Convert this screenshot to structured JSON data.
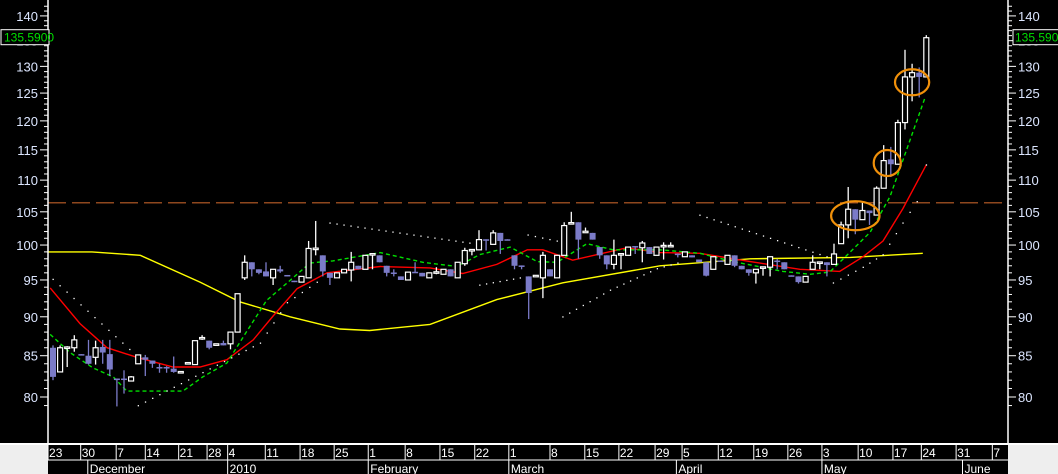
{
  "chart_data": {
    "type": "candlestick",
    "title": "",
    "scale": "log",
    "ylim": [
      79,
      142
    ],
    "y_ticks": [
      80,
      85,
      90,
      95,
      100,
      105,
      110,
      115,
      120,
      125,
      130,
      135,
      140
    ],
    "last_price_label": "135.5900",
    "reference_line": {
      "value": 106.4,
      "style": "dashed",
      "color": "#e07030"
    },
    "colors": {
      "up": "#ffffff",
      "down": "#7b7bc8",
      "ma_long": "#ffff00",
      "ma_mid": "#ff0000",
      "ma_fast": "#00e000",
      "sar": "#ffffff",
      "highlight": "#f0900a",
      "tag": "#00e000"
    },
    "candles_ohlc": [
      [
        86.0,
        86.3,
        82.0,
        82.4
      ],
      [
        83.0,
        86.3,
        83.0,
        86.0
      ],
      [
        86.1,
        86.2,
        83.6,
        86.1
      ],
      [
        86.0,
        87.6,
        85.5,
        87.0
      ],
      [
        85.2,
        85.2,
        85.1,
        85.1
      ],
      [
        85.0,
        87.0,
        83.9,
        84.0
      ],
      [
        84.8,
        86.9,
        83.9,
        86.0
      ],
      [
        86.1,
        87.0,
        84.0,
        85.4
      ],
      [
        85.2,
        87.0,
        82.5,
        83.3
      ],
      [
        82.2,
        82.2,
        78.9,
        82.1
      ],
      [
        82.2,
        83.2,
        80.4,
        82.1
      ],
      [
        81.9,
        82.5,
        81.9,
        82.4
      ],
      [
        84.0,
        85.1,
        84.0,
        85.1
      ],
      [
        84.8,
        85.1,
        82.5,
        84.5
      ],
      [
        84.4,
        84.4,
        83.5,
        84.0
      ],
      [
        83.6,
        84.0,
        82.9,
        83.5
      ],
      [
        83.6,
        83.7,
        82.9,
        83.5
      ],
      [
        83.4,
        84.9,
        82.9,
        83.0
      ],
      [
        83.0,
        83.0,
        83.0,
        83.05
      ],
      [
        84.1,
        84.1,
        84.1,
        84.15
      ],
      [
        83.9,
        86.9,
        83.9,
        86.9
      ],
      [
        87.3,
        87.6,
        87.0,
        87.3
      ],
      [
        86.9,
        86.9,
        85.8,
        86.0
      ],
      [
        86.3,
        86.5,
        86.3,
        86.5
      ],
      [
        86.6,
        86.9,
        86.3,
        86.3
      ],
      [
        86.5,
        88.0,
        85.8,
        88.0
      ],
      [
        88.0,
        93.1,
        88.0,
        93.1
      ],
      [
        95.3,
        98.5,
        95.0,
        97.5
      ],
      [
        97.5,
        97.5,
        95.5,
        96.5
      ],
      [
        96.5,
        96.5,
        95.8,
        96.0
      ],
      [
        96.2,
        97.5,
        95.5,
        95.5
      ],
      [
        95.3,
        96.5,
        94.3,
        96.5
      ],
      [
        96.5,
        97.0,
        96.0,
        96.2
      ],
      [
        95.7,
        95.7,
        95.5,
        95.6
      ],
      [
        94.9,
        94.9,
        94.7,
        94.8
      ],
      [
        94.7,
        95.5,
        94.7,
        95.5
      ],
      [
        95.3,
        100.6,
        95.3,
        99.5
      ],
      [
        99.5,
        103.6,
        98.5,
        99.55
      ],
      [
        98.5,
        98.5,
        95.5,
        96.2
      ],
      [
        96.0,
        96.0,
        94.3,
        95.3
      ],
      [
        95.3,
        96.0,
        95.3,
        96.0
      ],
      [
        96.0,
        96.5,
        96.0,
        96.5
      ],
      [
        96.4,
        99.0,
        94.8,
        97.5
      ],
      [
        97.0,
        97.0,
        96.5,
        96.5
      ],
      [
        96.5,
        98.5,
        96.5,
        98.5
      ],
      [
        98.7,
        98.7,
        96.5,
        98.75
      ],
      [
        98.5,
        98.5,
        97.5,
        97.5
      ],
      [
        97.0,
        97.0,
        95.5,
        96.0
      ],
      [
        96.05,
        96.5,
        95.5,
        96.0
      ],
      [
        95.5,
        95.5,
        95.0,
        95.0
      ],
      [
        95.0,
        96.1,
        95.0,
        96.1
      ],
      [
        96.15,
        97.5,
        96.1,
        96.1
      ],
      [
        96.0,
        96.0,
        95.5,
        95.5
      ],
      [
        95.3,
        96.0,
        95.3,
        96.0
      ],
      [
        96.1,
        96.8,
        95.8,
        96.15
      ],
      [
        95.8,
        96.5,
        95.8,
        96.5
      ],
      [
        96.5,
        96.5,
        95.5,
        95.5
      ],
      [
        95.3,
        97.5,
        95.3,
        97.5
      ],
      [
        97.3,
        99.6,
        97.0,
        99.2
      ],
      [
        99.3,
        99.3,
        98.5,
        99.35
      ],
      [
        99.3,
        102.2,
        99.3,
        100.8
      ],
      [
        100.85,
        100.85,
        99.2,
        100.8
      ],
      [
        100.1,
        102.2,
        100.1,
        101.8
      ],
      [
        101.8,
        101.8,
        98.7,
        100.6
      ],
      [
        100.85,
        100.85,
        100.8,
        100.8
      ],
      [
        98.5,
        98.5,
        96.5,
        97.0
      ],
      [
        97.05,
        97.05,
        96.5,
        97.0
      ],
      [
        95.5,
        95.5,
        89.7,
        93.2
      ],
      [
        95.6,
        95.6,
        95.6,
        95.65
      ],
      [
        95.3,
        99.0,
        92.5,
        98.5
      ],
      [
        96.5,
        96.5,
        95.5,
        95.5
      ],
      [
        95.3,
        98.5,
        95.3,
        98.5
      ],
      [
        98.5,
        103.4,
        98.5,
        102.9
      ],
      [
        103.3,
        105.0,
        103.3,
        103.35
      ],
      [
        103.4,
        103.4,
        98.0,
        100.8
      ],
      [
        102.0,
        102.6,
        102.0,
        102.05
      ],
      [
        101.8,
        101.8,
        100.8,
        100.8
      ],
      [
        99.7,
        99.7,
        98.0,
        98.5
      ],
      [
        98.5,
        98.5,
        96.5,
        97.2
      ],
      [
        97.2,
        100.8,
        96.5,
        98.5
      ],
      [
        98.7,
        98.7,
        96.5,
        98.75
      ],
      [
        98.5,
        99.7,
        98.5,
        99.7
      ],
      [
        99.85,
        99.85,
        98.7,
        99.8
      ],
      [
        99.6,
        100.6,
        97.5,
        100.3
      ],
      [
        99.7,
        99.7,
        98.7,
        98.7
      ],
      [
        98.5,
        99.7,
        98.5,
        99.7
      ],
      [
        99.9,
        100.4,
        97.9,
        99.95
      ],
      [
        99.9,
        100.4,
        99.9,
        99.95
      ],
      [
        98.75,
        98.75,
        98.2,
        98.7
      ],
      [
        98.3,
        99.0,
        98.3,
        99.0
      ],
      [
        98.5,
        98.5,
        98.2,
        98.2
      ],
      [
        97.9,
        97.9,
        97.5,
        97.5
      ],
      [
        97.5,
        97.5,
        95.5,
        95.6
      ],
      [
        96.5,
        98.3,
        96.5,
        98.3
      ],
      [
        97.75,
        97.75,
        97.7,
        97.7
      ],
      [
        97.2,
        98.5,
        97.2,
        98.5
      ],
      [
        98.5,
        98.5,
        96.8,
        97.0
      ],
      [
        97.0,
        97.0,
        96.5,
        96.5
      ],
      [
        96.5,
        96.5,
        95.6,
        96.0
      ],
      [
        96.0,
        96.5,
        94.5,
        96.5
      ],
      [
        96.8,
        96.8,
        95.6,
        96.85
      ],
      [
        96.8,
        98.3,
        95.5,
        98.3
      ],
      [
        97.75,
        98.0,
        96.5,
        97.7
      ],
      [
        97.5,
        97.5,
        96.5,
        96.5
      ],
      [
        95.65,
        95.65,
        95.6,
        95.6
      ],
      [
        95.5,
        95.5,
        94.5,
        94.7
      ],
      [
        94.7,
        95.5,
        94.7,
        95.5
      ],
      [
        96.5,
        98.5,
        96.5,
        97.5
      ],
      [
        97.5,
        97.5,
        96.5,
        97.55
      ],
      [
        97.5,
        97.5,
        95.5,
        97.1
      ],
      [
        97.2,
        100.2,
        97.2,
        98.7
      ],
      [
        100.2,
        103.5,
        100.2,
        103.0
      ],
      [
        103.0,
        108.9,
        101.0,
        105.4
      ],
      [
        105.4,
        105.4,
        101.6,
        103.8
      ],
      [
        103.8,
        106.5,
        103.8,
        105.2
      ],
      [
        105.2,
        105.2,
        103.0,
        104.8
      ],
      [
        104.5,
        109.0,
        104.5,
        108.7
      ],
      [
        108.7,
        115.8,
        108.7,
        113.2
      ],
      [
        113.4,
        115.5,
        110.5,
        112.6
      ],
      [
        112.6,
        120.2,
        112.6,
        119.7
      ],
      [
        119.7,
        133.2,
        118.5,
        128.0
      ],
      [
        128.0,
        130.5,
        123.5,
        128.8
      ],
      [
        128.8,
        129.8,
        124.2,
        128.0
      ],
      [
        128.0,
        136.1,
        128.0,
        135.59
      ]
    ],
    "ma_long": [
      [
        -0.8,
        99.0
      ],
      [
        5.5,
        99.0
      ],
      [
        12.3,
        98.5
      ],
      [
        20.7,
        94.7
      ],
      [
        26.3,
        92.0
      ],
      [
        33.4,
        90.0
      ],
      [
        40.4,
        88.4
      ],
      [
        44.6,
        88.2
      ],
      [
        53.1,
        89.0
      ],
      [
        62.5,
        92.3
      ],
      [
        71.8,
        94.6
      ],
      [
        85.5,
        97.0
      ],
      [
        98.2,
        98.0
      ],
      [
        112.3,
        98.2
      ],
      [
        122.5,
        98.8
      ]
    ],
    "ma_mid": [
      [
        -0.4,
        93.9
      ],
      [
        3.8,
        89.1
      ],
      [
        7.6,
        86.0
      ],
      [
        11.8,
        84.8
      ],
      [
        16.9,
        83.6
      ],
      [
        20.7,
        83.6
      ],
      [
        24.5,
        84.5
      ],
      [
        28.2,
        87.0
      ],
      [
        31,
        90.1
      ],
      [
        34.4,
        93.8
      ],
      [
        38.6,
        96.0
      ],
      [
        46.1,
        96.9
      ],
      [
        53.1,
        96.7
      ],
      [
        57.7,
        95.9
      ],
      [
        62.5,
        97.2
      ],
      [
        66.8,
        99.3
      ],
      [
        69,
        99.3
      ],
      [
        73.2,
        97.8
      ],
      [
        80.8,
        99.6
      ],
      [
        85.5,
        98.9
      ],
      [
        91.1,
        98.8
      ],
      [
        98.2,
        97.6
      ],
      [
        105.2,
        96.5
      ],
      [
        110.8,
        96.2
      ],
      [
        114.1,
        98.3
      ],
      [
        116.9,
        100.6
      ],
      [
        119.7,
        105.5
      ],
      [
        123,
        112.5
      ]
    ],
    "ma_fast": [
      [
        -0.4,
        87.7
      ],
      [
        2.4,
        85.4
      ],
      [
        5.6,
        83.5
      ],
      [
        8.5,
        82.4
      ],
      [
        10.4,
        80.7
      ],
      [
        18.3,
        80.7
      ],
      [
        21.1,
        82.4
      ],
      [
        24.5,
        84.1
      ],
      [
        27.3,
        88.1
      ],
      [
        30.1,
        92.2
      ],
      [
        33,
        94.6
      ],
      [
        36.2,
        97.4
      ],
      [
        39.4,
        97.7
      ],
      [
        46.1,
        98.9
      ],
      [
        52.1,
        97.5
      ],
      [
        56.9,
        96.9
      ],
      [
        60.1,
        98.6
      ],
      [
        64.4,
        99.7
      ],
      [
        68.2,
        97.6
      ],
      [
        71,
        97.5
      ],
      [
        75.2,
        100.2
      ],
      [
        78.9,
        99.3
      ],
      [
        85.5,
        99.3
      ],
      [
        91.1,
        98.8
      ],
      [
        95.8,
        97.6
      ],
      [
        102.8,
        96.2
      ],
      [
        106.6,
        95.8
      ],
      [
        109.4,
        96.1
      ],
      [
        112.3,
        99.0
      ],
      [
        115.1,
        101.9
      ],
      [
        117.9,
        107.4
      ],
      [
        122.8,
        124.1
      ]
    ],
    "sar_segments": [
      [
        [
          0,
          95.1
        ],
        [
          10.8,
          85.8
        ]
      ],
      [
        [
          12,
          79.0
        ],
        [
          29.2,
          86.6
        ],
        [
          33,
          91.9
        ],
        [
          37.2,
          94.7
        ]
      ],
      [
        [
          39,
          103.3
        ],
        [
          58.7,
          100.3
        ]
      ],
      [
        [
          60.1,
          94.3
        ],
        [
          65.8,
          95.3
        ]
      ],
      [
        [
          66.9,
          101.5
        ],
        [
          71,
          100.6
        ]
      ],
      [
        [
          71.8,
          90.0
        ],
        [
          78.5,
          93.6
        ],
        [
          85.1,
          96.6
        ],
        [
          88,
          97.4
        ]
      ],
      [
        [
          91.1,
          104.5
        ],
        [
          109,
          98.3
        ]
      ],
      [
        [
          109.9,
          94.6
        ],
        [
          114.1,
          96.8
        ],
        [
          116.9,
          98.6
        ],
        [
          119.7,
          103.3
        ],
        [
          121.7,
          106.6
        ],
        [
          123,
          112.5
        ]
      ]
    ],
    "highlights": [
      {
        "from": 111,
        "to": 115,
        "price": 104.4
      },
      {
        "from": 117,
        "to": 118,
        "price": 112.8
      },
      {
        "from": 120,
        "to": 122,
        "price": 127.0
      }
    ],
    "x_ticks": [
      {
        "label": "23",
        "at": -0.7
      },
      {
        "label": "30",
        "at": 3.9
      },
      {
        "label": "7",
        "at": 8.9
      },
      {
        "label": "14",
        "at": 13
      },
      {
        "label": "21",
        "at": 17.7
      },
      {
        "label": "28",
        "at": 21.7
      },
      {
        "label": "4",
        "at": 24.6
      },
      {
        "label": "11",
        "at": 29.9
      },
      {
        "label": "18",
        "at": 34.8
      },
      {
        "label": "25",
        "at": 39.6
      },
      {
        "label": "1",
        "at": 44.4
      },
      {
        "label": "8",
        "at": 49.6
      },
      {
        "label": "15",
        "at": 54.5
      },
      {
        "label": "22",
        "at": 59.4
      },
      {
        "label": "1",
        "at": 64.2
      },
      {
        "label": "8",
        "at": 70
      },
      {
        "label": "15",
        "at": 74.9
      },
      {
        "label": "22",
        "at": 79.7
      },
      {
        "label": "29",
        "at": 84.8
      },
      {
        "label": "5",
        "at": 88.6
      },
      {
        "label": "12",
        "at": 93.7
      },
      {
        "label": "19",
        "at": 98.7
      },
      {
        "label": "26",
        "at": 103.5
      },
      {
        "label": "3",
        "at": 108.3
      },
      {
        "label": "10",
        "at": 113.4
      },
      {
        "label": "17",
        "at": 118.3
      },
      {
        "label": "24",
        "at": 122.3
      },
      {
        "label": "31",
        "at": 127.2
      },
      {
        "label": "7",
        "at": 132.3
      }
    ],
    "x_months": [
      {
        "label": "December",
        "at": 4.9
      },
      {
        "label": "2010",
        "at": 24.6
      },
      {
        "label": "February",
        "at": 44.4
      },
      {
        "label": "March",
        "at": 64.2
      },
      {
        "label": "April",
        "at": 87.8
      },
      {
        "label": "May",
        "at": 108.3
      },
      {
        "label": "June",
        "at": 128.1
      }
    ]
  }
}
